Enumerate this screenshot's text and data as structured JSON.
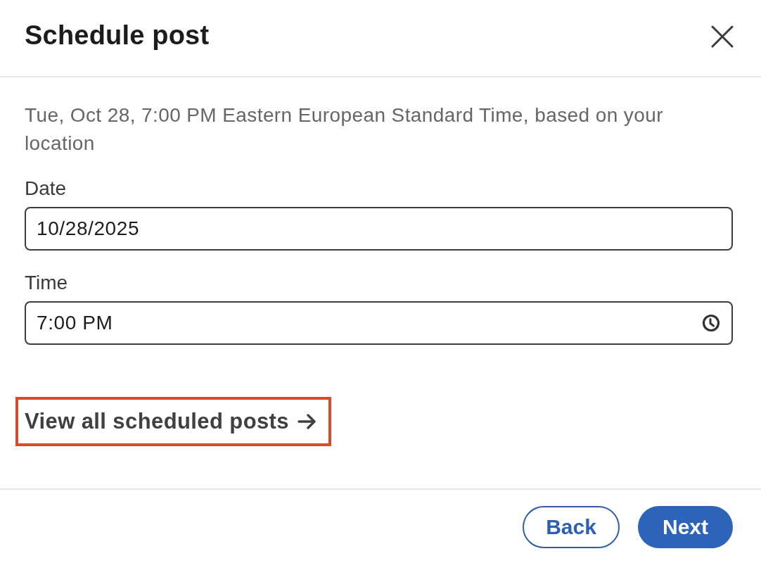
{
  "dialog": {
    "title": "Schedule post"
  },
  "summary": "Tue, Oct 28, 7:00 PM Eastern European Standard Time, based on your location",
  "fields": [
    {
      "kind": "date",
      "label": "Date",
      "value": "10/28/2025"
    },
    {
      "kind": "time",
      "label": "Time",
      "value": "7:00 PM"
    }
  ],
  "link": {
    "label": "View all scheduled posts",
    "highlighted": true
  },
  "buttons": [
    {
      "label": "Back",
      "kind": "secondary"
    },
    {
      "label": "Next",
      "kind": "primary"
    }
  ]
}
